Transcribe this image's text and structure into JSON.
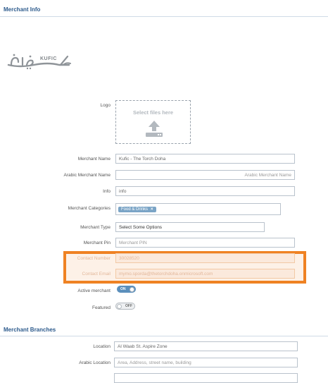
{
  "merchant_info": {
    "title": "Merchant Info",
    "logo_latin": "KUFIC",
    "logo_label": "Logo",
    "dropzone_text": "Select files here",
    "merchant_name": {
      "label": "Merchant Name",
      "value": "Kufic - The Torch Doha"
    },
    "arabic_merchant_name": {
      "label": "Arabic Merchant Name",
      "placeholder": "Arabic Merchant Name"
    },
    "info": {
      "label": "Info",
      "value": "info"
    },
    "merchant_categories": {
      "label": "Merchant Categories",
      "tags": [
        "Food & Drinks"
      ]
    },
    "merchant_type": {
      "label": "Merchant Type",
      "value": "Select Some Options"
    },
    "merchant_pin": {
      "label": "Merchant Pin",
      "placeholder": "Merchant PIN"
    },
    "contact_number": {
      "label": "Contact Number",
      "value": "30028520"
    },
    "contact_email": {
      "label": "Contact Email",
      "value": "mymo.sporda@thetorchdoha.onmicrosoft.com"
    },
    "active_merchant": {
      "label": "Active merchant",
      "state": "ON"
    },
    "featured": {
      "label": "Featured",
      "state": "OFF"
    }
  },
  "merchant_branches": {
    "title": "Merchant Branches",
    "location": {
      "label": "Location",
      "value": "Al Waab St. Aspire Zone"
    },
    "arabic_location": {
      "label": "Arabic Location",
      "placeholder": "Area, Address, street name, building"
    }
  },
  "colors": {
    "accent": "#2c5a8c",
    "highlight": "#ef8223",
    "tag": "#7aa4c6",
    "toggle_on": "#5b8fbc"
  }
}
